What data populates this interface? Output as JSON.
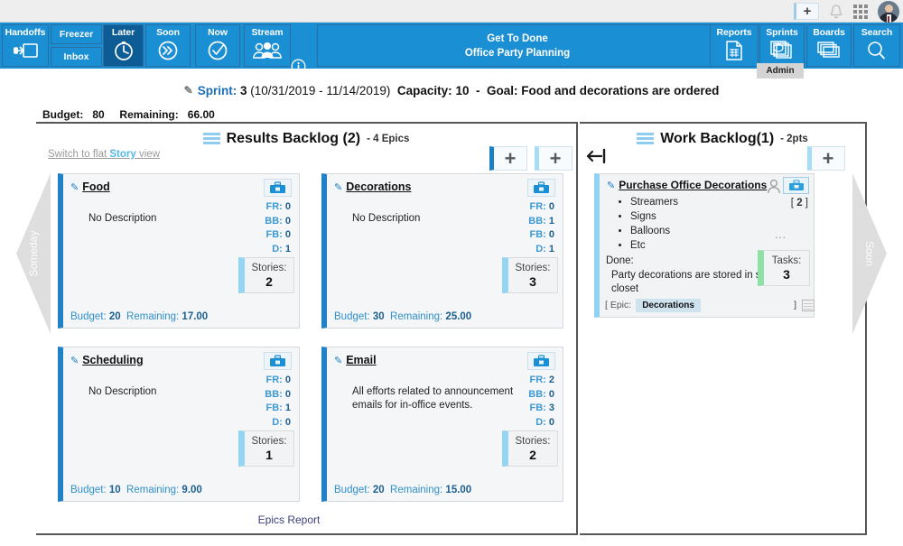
{
  "chrome": {
    "add_icon": "plus-icon",
    "bell_icon": "bell-icon",
    "apps_icon": "grid-apps-icon",
    "avatar_icon": "user-avatar"
  },
  "nav": {
    "tiles": [
      {
        "label": "Handoffs",
        "icon": "handoff-icon",
        "active": false
      },
      {
        "label": "Later",
        "icon": "clock-icon",
        "active": true
      },
      {
        "label": "Soon",
        "icon": "chevrons-icon",
        "active": false
      },
      {
        "label": "Now",
        "icon": "check-icon",
        "active": false
      },
      {
        "label": "Stream",
        "icon": "people-icon",
        "active": false
      }
    ],
    "stack": {
      "top": "Freezer",
      "bottom": "Inbox"
    },
    "info_icon": "info-icon",
    "brand_line1": "Get To Done",
    "brand_line2": "Office Party Planning",
    "right_tiles": [
      {
        "label": "Reports",
        "icon": "report-icon"
      },
      {
        "label": "Sprints",
        "icon": "sprints-icon"
      },
      {
        "label": "Boards",
        "icon": "boards-icon"
      },
      {
        "label": "Search",
        "icon": "search-icon"
      }
    ],
    "admin_tooltip": "Admin"
  },
  "sprint": {
    "pencil_icon": "pencil-icon",
    "label": "Sprint:",
    "number": "3",
    "dates": "(10/31/2019 - 11/14/2019)",
    "capacity_label": "Capacity:",
    "capacity_value": "10",
    "separator": "-",
    "goal_label": "Goal:",
    "goal_value": "Food and decorations are ordered"
  },
  "budget": {
    "budget_label": "Budget:",
    "budget_value": "80",
    "remaining_label": "Remaining:",
    "remaining_value": "66.00"
  },
  "results_panel": {
    "menu_icon": "hamburger-icon",
    "title": "Results Backlog (2)",
    "subtitle": "- 4 Epics",
    "switch_link_pre": "Switch to flat ",
    "switch_link_hl": "Story",
    "switch_link_post": " view",
    "add_epic_button": "+",
    "add_story_button": "+",
    "left_wedge_label": "Someday",
    "footer_link": "Epics Report",
    "epics": [
      {
        "title": "Food",
        "description": "No Description",
        "toolbox_icon": "toolbox-icon",
        "metrics": [
          {
            "key": "FR:",
            "value": "0"
          },
          {
            "key": "BB:",
            "value": "0"
          },
          {
            "key": "FB:",
            "value": "0"
          },
          {
            "key": "D:",
            "value": "1"
          }
        ],
        "stories_label": "Stories:",
        "stories_value": "2",
        "budget_label": "Budget:",
        "budget_value": "20",
        "remaining_label": "Remaining:",
        "remaining_value": "17.00"
      },
      {
        "title": "Decorations",
        "description": "No Description",
        "toolbox_icon": "toolbox-icon",
        "metrics": [
          {
            "key": "FR:",
            "value": "0"
          },
          {
            "key": "BB:",
            "value": "1"
          },
          {
            "key": "FB:",
            "value": "0"
          },
          {
            "key": "D:",
            "value": "1"
          }
        ],
        "stories_label": "Stories:",
        "stories_value": "3",
        "budget_label": "Budget:",
        "budget_value": "30",
        "remaining_label": "Remaining:",
        "remaining_value": "25.00"
      },
      {
        "title": "Scheduling",
        "description": "No Description",
        "toolbox_icon": "toolbox-icon",
        "metrics": [
          {
            "key": "FR:",
            "value": "0"
          },
          {
            "key": "BB:",
            "value": "0"
          },
          {
            "key": "FB:",
            "value": "1"
          },
          {
            "key": "D:",
            "value": "0"
          }
        ],
        "stories_label": "Stories:",
        "stories_value": "1",
        "budget_label": "Budget:",
        "budget_value": "10",
        "remaining_label": "Remaining:",
        "remaining_value": "9.00"
      },
      {
        "title": "Email",
        "description": "All efforts related to announcement emails for in-office events.",
        "toolbox_icon": "toolbox-icon",
        "metrics": [
          {
            "key": "FR:",
            "value": "2"
          },
          {
            "key": "BB:",
            "value": "0"
          },
          {
            "key": "FB:",
            "value": "3"
          },
          {
            "key": "D:",
            "value": "0"
          }
        ],
        "stories_label": "Stories:",
        "stories_value": "2",
        "budget_label": "Budget:",
        "budget_value": "20",
        "remaining_label": "Remaining:",
        "remaining_value": "15.00"
      }
    ]
  },
  "work_panel": {
    "menu_icon": "hamburger-icon",
    "title": "Work Backlog(1)",
    "subtitle": "- 2pts",
    "back_arrow_icon": "arrow-to-bar-icon",
    "add_story_button": "+",
    "right_wedge_label": "Soon",
    "story": {
      "title": "Purchase Office Decorations",
      "person_icon": "person-icon",
      "toolbox_icon": "toolbox-icon",
      "points_open": "[",
      "points": "2",
      "points_close": "]",
      "bullets": [
        "Streamers",
        "Signs",
        "Balloons",
        "Etc"
      ],
      "overflow": "...",
      "done_label": "Done:",
      "done_text": "Party decorations are stored in supply closet",
      "tasks_label": "Tasks:",
      "tasks_value": "3",
      "epic_open": "[ Epic:",
      "epic_chip": "Decorations",
      "epic_close": "]",
      "calendar_icon": "calendar-icon"
    }
  },
  "colors": {
    "nav_blue": "#1b8fd4",
    "nav_active": "#0d5c96",
    "accent_light": "#8ecdf0",
    "metric_blue": "#3f9ad4",
    "tasks_green": "#8fe0a4"
  }
}
